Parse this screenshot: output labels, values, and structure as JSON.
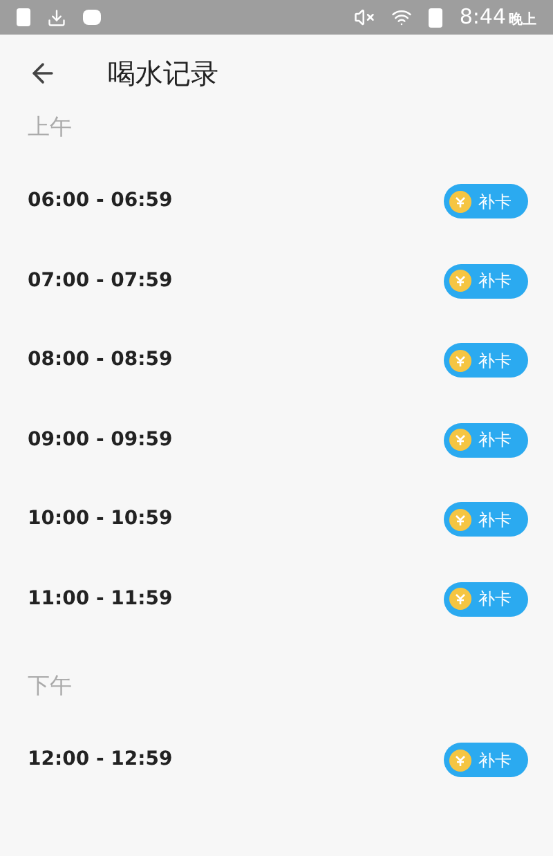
{
  "status_bar": {
    "time": "8:44",
    "period": "晚上"
  },
  "header": {
    "title": "喝水记录"
  },
  "sections": [
    {
      "label": "上午",
      "rows": [
        {
          "time": "06:00 - 06:59",
          "action": "补卡"
        },
        {
          "time": "07:00 - 07:59",
          "action": "补卡"
        },
        {
          "time": "08:00 - 08:59",
          "action": "补卡"
        },
        {
          "time": "09:00 - 09:59",
          "action": "补卡"
        },
        {
          "time": "10:00 - 10:59",
          "action": "补卡"
        },
        {
          "time": "11:00 - 11:59",
          "action": "补卡"
        }
      ]
    },
    {
      "label": "下午",
      "rows": [
        {
          "time": "12:00 - 12:59",
          "action": "补卡"
        }
      ]
    }
  ]
}
